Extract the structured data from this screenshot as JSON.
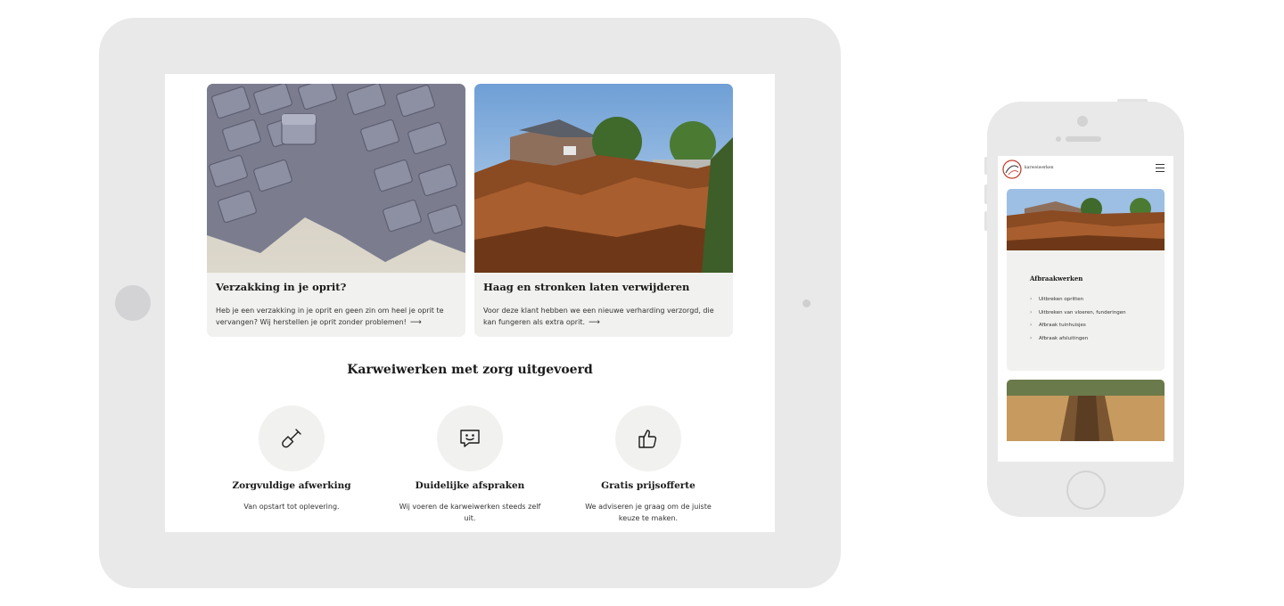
{
  "tablet": {
    "cards": [
      {
        "title": "Verzakking in je oprit?",
        "text": "Heb je een verzakking in je oprit en geen zin om heel je oprit te vervangen? Wij herstellen je oprit zonder problemen!",
        "arrow": "⟶",
        "image_icon": "paving-stones-image"
      },
      {
        "title": "Haag en stronken laten verwijderen",
        "text": "Voor deze klant hebben we een nieuwe verharding verzorgd, die kan fungeren als extra oprit.",
        "arrow": "⟶",
        "image_icon": "hedge-stumps-image"
      }
    ],
    "section_title": "Karweiwerken met zorg uitgevoerd",
    "features": [
      {
        "icon": "shovel-icon",
        "title": "Zorgvuldige afwerking",
        "text": "Van opstart tot oplevering."
      },
      {
        "icon": "chat-smile-icon",
        "title": "Duidelijke afspraken",
        "text": "Wij voeren de karweiwerken steeds zelf uit."
      },
      {
        "icon": "thumbs-up-icon",
        "title": "Gratis prijsofferte",
        "text": "We adviseren je graag om de juiste keuze te maken."
      }
    ]
  },
  "phone": {
    "brand": "karweiwerken",
    "menu_icon": "hamburger-menu-icon",
    "card": {
      "title": "Afbraakwerken",
      "items": [
        "Uitbreken opritten",
        "Uitbreken van vloeren, funderingen",
        "Afbraak tuinhuisjes",
        "Afbraak afsluitingen"
      ]
    }
  },
  "colors": {
    "card_bg": "#f1f1ef",
    "device_frame": "#e9e9e9",
    "text": "#1a1a1a",
    "logo_accent": "#c0392b"
  }
}
